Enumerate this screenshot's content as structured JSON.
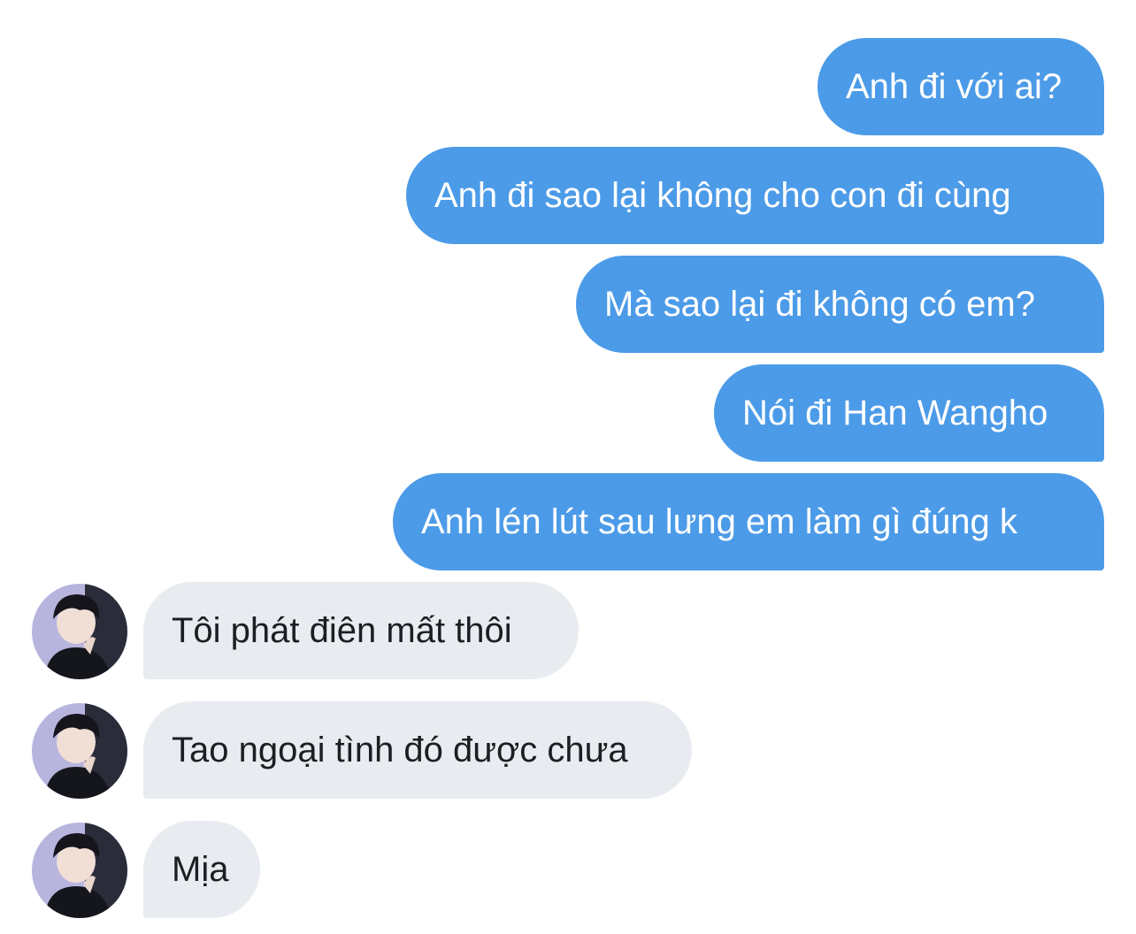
{
  "colors": {
    "sent_bubble": "#4c9be8",
    "received_bubble": "#e8ecf0",
    "sent_text": "#ffffff",
    "received_text": "#1b1f23"
  },
  "messages_sent": [
    {
      "text": "Anh đi với ai?"
    },
    {
      "text": "Anh đi sao lại không cho con đi cùng"
    },
    {
      "text": "Mà sao lại đi không có em?"
    },
    {
      "text": "Nói đi Han Wangho"
    },
    {
      "text": "Anh lén lút sau lưng em làm gì đúng k"
    }
  ],
  "messages_received": [
    {
      "text": "Tôi phát điên mất thôi",
      "avatar": "user-avatar-photo"
    },
    {
      "text": "Tao ngoại tình đó được chưa",
      "avatar": "user-avatar-photo"
    },
    {
      "text": "Mịa",
      "avatar": "user-avatar-photo"
    }
  ]
}
